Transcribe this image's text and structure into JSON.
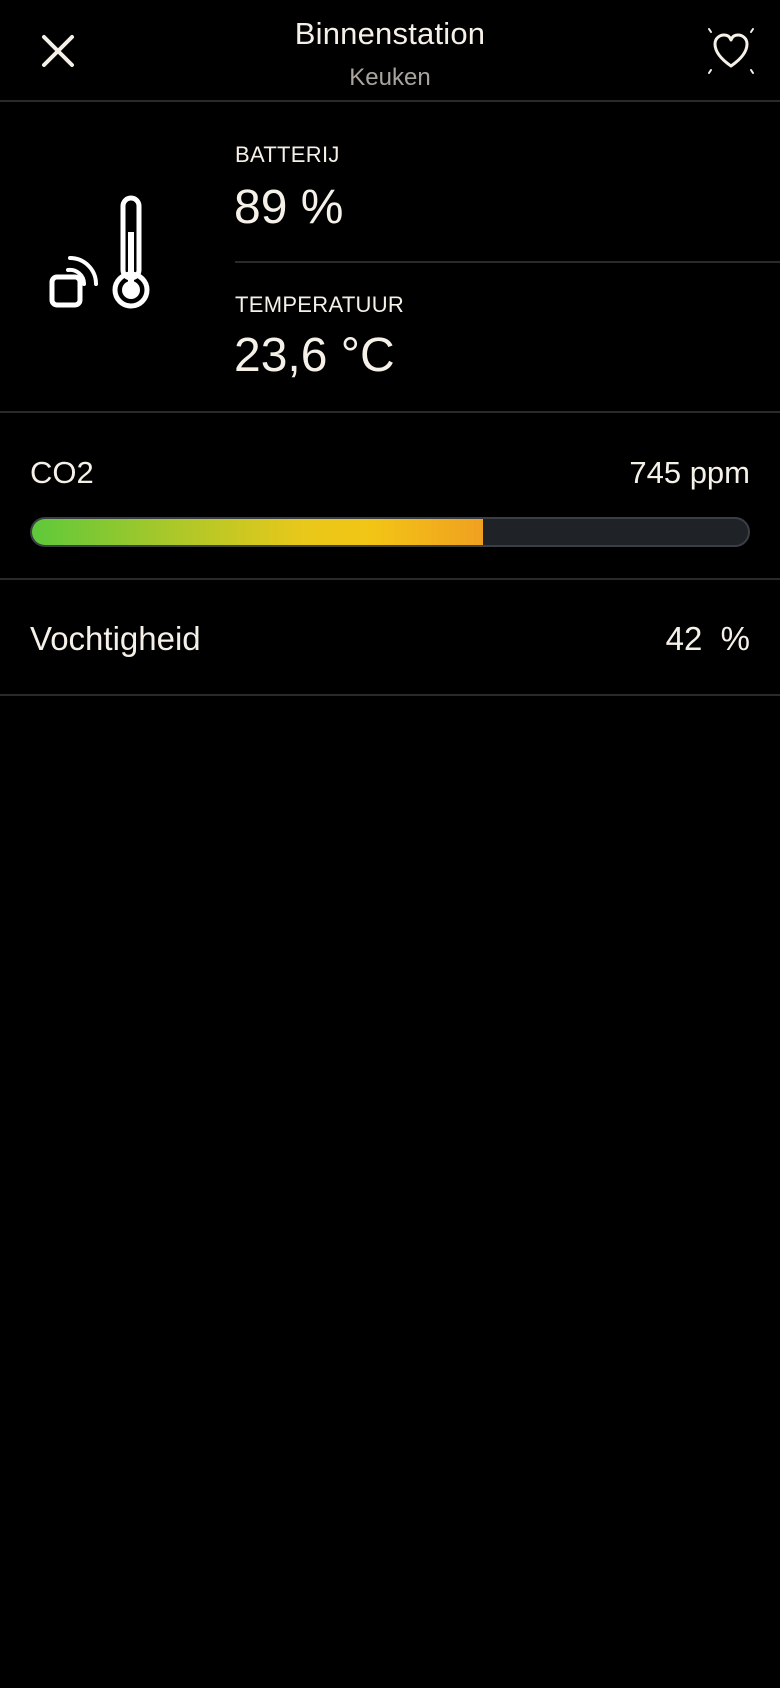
{
  "header": {
    "title": "Binnenstation",
    "subtitle": "Keuken",
    "close_icon": "close-icon",
    "favorite_icon": "heart-sparkle-icon"
  },
  "device": {
    "icon": "thermometer-wireless-icon",
    "battery": {
      "label": "BATTERIJ",
      "value": "89 %"
    },
    "temperature": {
      "label": "TEMPERATUUR",
      "value": "23,6 °C"
    }
  },
  "co2": {
    "label": "CO2",
    "value": "745 ppm",
    "level_fraction": 0.63
  },
  "humidity": {
    "label": "Vochtigheid",
    "value": "42  %"
  },
  "colors": {
    "background": "#000000",
    "text": "#f6f1e8",
    "muted_text": "#a9a59e",
    "divider": "#2a2a2a",
    "bar_track": "#1f2227",
    "bar_gradient_start": "#5ec93a",
    "bar_gradient_mid": "#f2c515",
    "bar_gradient_end": "#f0a020"
  }
}
